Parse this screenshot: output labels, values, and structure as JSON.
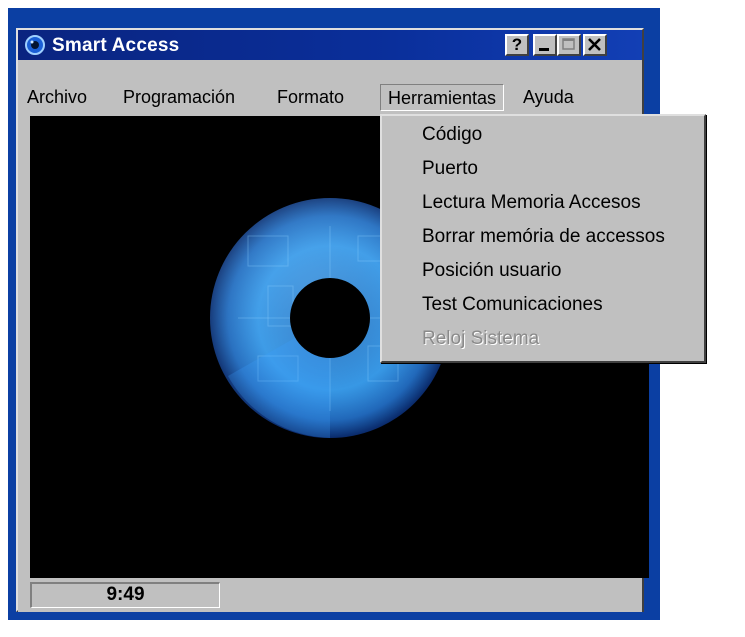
{
  "window": {
    "title": "Smart Access",
    "title_buttons": {
      "help": "?",
      "minimize": "_",
      "maximize": "□",
      "close": "✕"
    }
  },
  "menubar": {
    "items": [
      {
        "label": "Archivo"
      },
      {
        "label": "Programación"
      },
      {
        "label": "Formato"
      },
      {
        "label": "Herramientas",
        "active": true
      },
      {
        "label": "Ayuda"
      }
    ]
  },
  "dropdown": {
    "items": [
      {
        "label": "Código",
        "enabled": true
      },
      {
        "label": "Puerto",
        "enabled": true
      },
      {
        "label": "Lectura Memoria Accesos",
        "enabled": true
      },
      {
        "label": "Borrar memória de accessos",
        "enabled": true
      },
      {
        "label": "Posición usuario",
        "enabled": true
      },
      {
        "label": "Test Comunicaciones",
        "enabled": true
      },
      {
        "label": "Reloj Sistema",
        "enabled": false
      }
    ]
  },
  "statusbar": {
    "time": "9:49"
  },
  "icons": {
    "app": "app-logo-icon",
    "client_image": "iris-eye-image"
  },
  "colors": {
    "titlebar": "#0a2480",
    "menu_bg": "#c0c0c0",
    "client_bg": "#000000",
    "disabled_text": "#8a8a8a"
  }
}
